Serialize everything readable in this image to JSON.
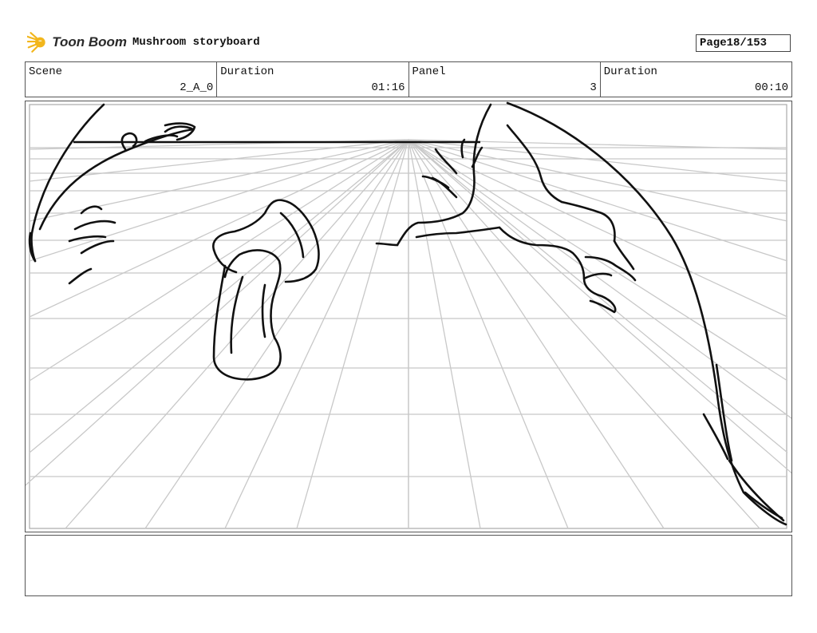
{
  "header": {
    "logo_text": "Toon Boom",
    "title": "Mushroom storyboard",
    "page_label": "Page",
    "page_value": "18/153"
  },
  "info": {
    "scene_label": "Scene",
    "scene_value": "2_A_0",
    "duration1_label": "Duration",
    "duration1_value": "01:16",
    "panel_label": "Panel",
    "panel_value": "3",
    "duration2_label": "Duration",
    "duration2_value": "00:10"
  },
  "colors": {
    "logo_accent": "#f2b61c",
    "grid_line": "#c8c8c8",
    "sketch_line": "#111111"
  },
  "notes": {
    "text": ""
  }
}
